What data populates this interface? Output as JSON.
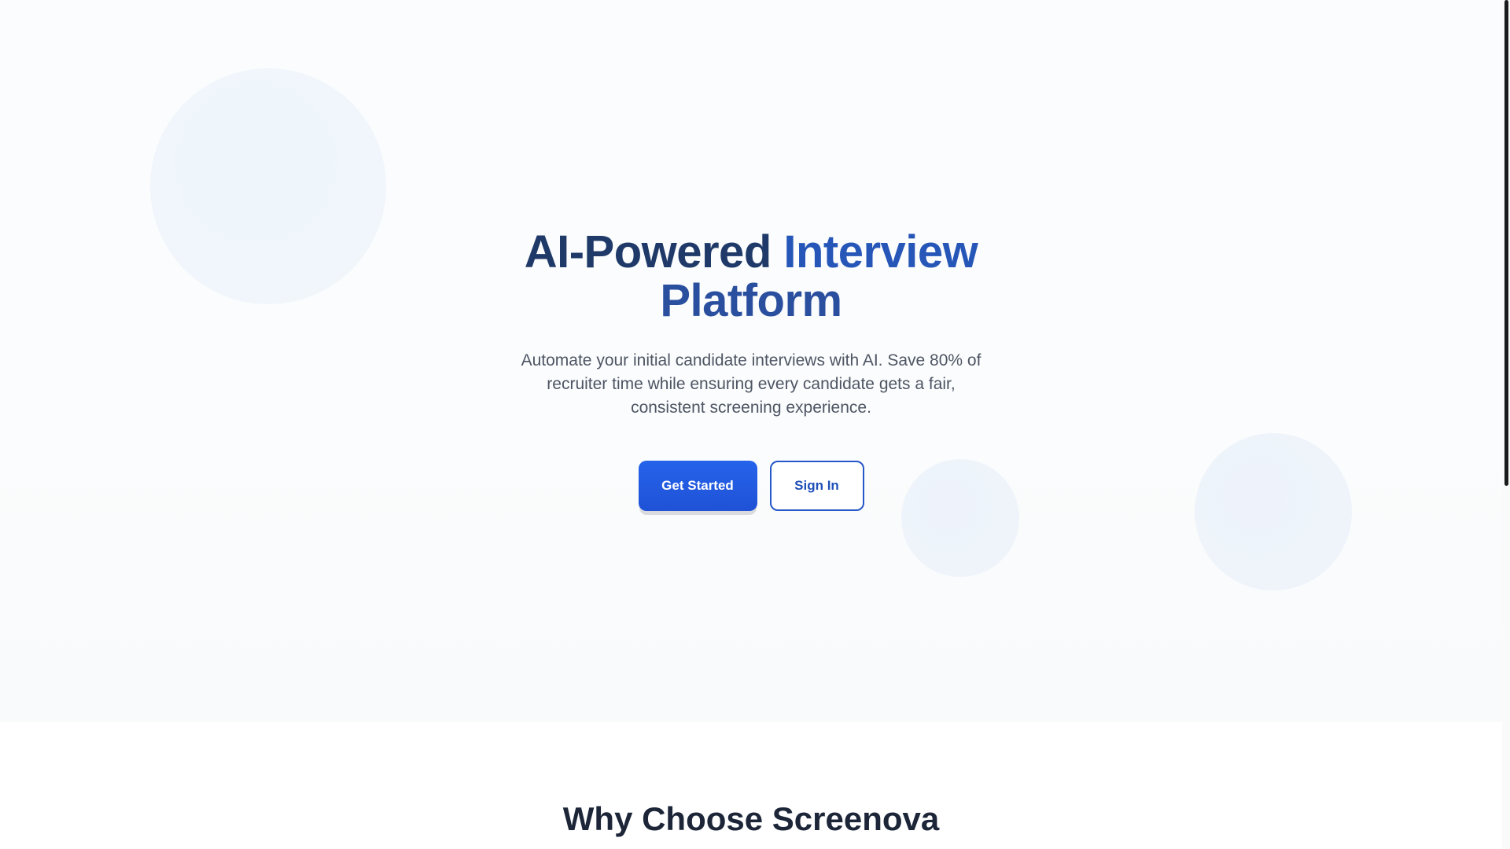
{
  "hero": {
    "title_part1": "AI-Powered ",
    "title_part2": "Interview",
    "title_part3": "Platform",
    "subtitle": "Automate your initial candidate interviews with AI. Save 80% of recruiter time while ensuring every candidate gets a fair, consistent screening experience.",
    "primary_button": "Get Started",
    "secondary_button": "Sign In"
  },
  "why_section": {
    "title": "Why Choose Screenova"
  },
  "colors": {
    "primary": "#2563eb",
    "heading_dark": "#1f3a68",
    "heading_accent": "#2657b8",
    "text_muted": "#4d5563"
  }
}
